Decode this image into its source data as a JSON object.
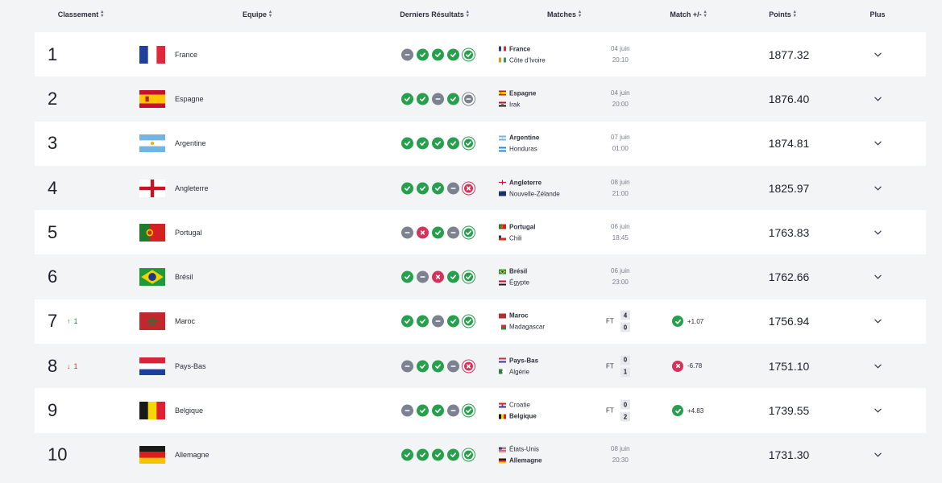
{
  "headers": {
    "rank": "Classement",
    "team": "Equipe",
    "results": "Derniers Résultats",
    "matches": "Matches",
    "match_delta": "Match +/-",
    "points": "Points",
    "more": "Plus"
  },
  "icons": {
    "sort": "sort-icon",
    "win": "check-icon",
    "draw": "minus-icon",
    "loss": "cross-icon",
    "more": "chevron-down-icon"
  },
  "colors": {
    "win": "#27a04d",
    "draw": "#7d8291",
    "loss": "#d7325a",
    "up": "#1e8a3c",
    "down": "#d42848"
  },
  "rows": [
    {
      "rank": "1",
      "team": "France",
      "flag": "fr",
      "results": [
        "D",
        "W",
        "W",
        "W",
        "W"
      ],
      "match": {
        "home": "France",
        "home_flag": "fr",
        "away": "Côte d'Ivoire",
        "away_flag": "ci",
        "bold": "home",
        "date": "04 juin",
        "time": "20:10"
      },
      "points": "1877.32"
    },
    {
      "rank": "2",
      "team": "Espagne",
      "flag": "es",
      "results": [
        "W",
        "W",
        "D",
        "W",
        "D"
      ],
      "match": {
        "home": "Espagne",
        "home_flag": "es",
        "away": "Irak",
        "away_flag": "iq",
        "bold": "home",
        "date": "04 juin",
        "time": "20:00"
      },
      "points": "1876.40"
    },
    {
      "rank": "3",
      "team": "Argentine",
      "flag": "ar",
      "results": [
        "W",
        "W",
        "W",
        "W",
        "W"
      ],
      "match": {
        "home": "Argentine",
        "home_flag": "ar",
        "away": "Honduras",
        "away_flag": "hn",
        "bold": "home",
        "date": "07 juin",
        "time": "01:00"
      },
      "points": "1874.81"
    },
    {
      "rank": "4",
      "team": "Angleterre",
      "flag": "en",
      "results": [
        "W",
        "W",
        "W",
        "D",
        "L"
      ],
      "match": {
        "home": "Angleterre",
        "home_flag": "en",
        "away": "Nouvelle-Zélande",
        "away_flag": "nz",
        "bold": "home",
        "date": "08 juin",
        "time": "21:00"
      },
      "points": "1825.97"
    },
    {
      "rank": "5",
      "team": "Portugal",
      "flag": "pt",
      "results": [
        "D",
        "L",
        "W",
        "D",
        "W"
      ],
      "match": {
        "home": "Portugal",
        "home_flag": "pt",
        "away": "Chili",
        "away_flag": "cl",
        "bold": "home",
        "date": "06 juin",
        "time": "18:45"
      },
      "points": "1763.83"
    },
    {
      "rank": "6",
      "team": "Brésil",
      "flag": "br",
      "results": [
        "W",
        "D",
        "L",
        "W",
        "W"
      ],
      "match": {
        "home": "Brésil",
        "home_flag": "br",
        "away": "Égypte",
        "away_flag": "eg",
        "bold": "home",
        "date": "06 juin",
        "time": "23:00"
      },
      "points": "1762.66"
    },
    {
      "rank": "7",
      "delta": {
        "dir": "up",
        "arrow": "↑",
        "value": "1"
      },
      "team": "Maroc",
      "flag": "ma",
      "results": [
        "W",
        "W",
        "D",
        "W",
        "W"
      ],
      "match": {
        "home": "Maroc",
        "home_flag": "ma",
        "away": "Madagascar",
        "away_flag": "mg",
        "bold": "home",
        "status": "FT",
        "home_score": "4",
        "away_score": "0",
        "delta_result": "W",
        "delta_value": "+1.07"
      },
      "points": "1756.94"
    },
    {
      "rank": "8",
      "delta": {
        "dir": "down",
        "arrow": "↓",
        "value": "1"
      },
      "team": "Pays-Bas",
      "flag": "nl",
      "results": [
        "D",
        "W",
        "W",
        "D",
        "L"
      ],
      "match": {
        "home": "Pays-Bas",
        "home_flag": "nl",
        "away": "Algérie",
        "away_flag": "dz",
        "bold": "home",
        "status": "FT",
        "home_score": "0",
        "away_score": "1",
        "delta_result": "L",
        "delta_value": "-6.78"
      },
      "points": "1751.10"
    },
    {
      "rank": "9",
      "team": "Belgique",
      "flag": "be",
      "results": [
        "D",
        "W",
        "W",
        "D",
        "W"
      ],
      "match": {
        "home": "Croatie",
        "home_flag": "hr",
        "away": "Belgique",
        "away_flag": "be",
        "bold": "away",
        "status": "FT",
        "home_score": "0",
        "away_score": "2",
        "delta_result": "W",
        "delta_value": "+4.83"
      },
      "points": "1739.55"
    },
    {
      "rank": "10",
      "team": "Allemagne",
      "flag": "de",
      "results": [
        "W",
        "W",
        "W",
        "W",
        "W"
      ],
      "match": {
        "home": "États-Unis",
        "home_flag": "us",
        "away": "Allemagne",
        "away_flag": "de",
        "bold": "away",
        "date": "08 juin",
        "time": "20:30"
      },
      "points": "1731.30"
    }
  ]
}
